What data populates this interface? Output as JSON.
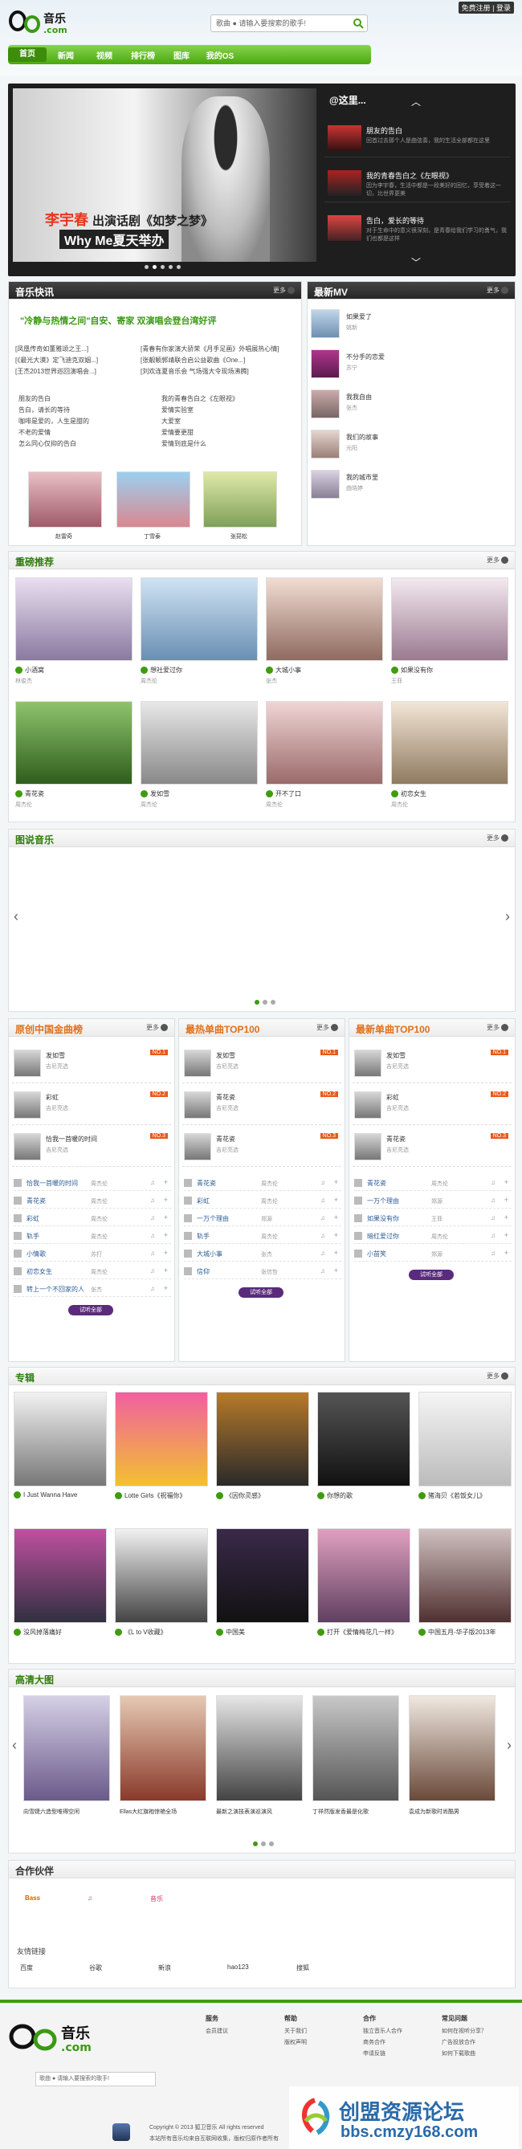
{
  "header": {
    "search_placeholder": "歌曲 ● 请输入要搜索的歌手!",
    "login": "免费注册 | 登录"
  },
  "nav": [
    "首页",
    "新闻",
    "视频",
    "排行榜",
    "图库",
    "我的OS"
  ],
  "banner": {
    "caption_name": "李宇春",
    "caption_title": "出演话剧《如梦之梦》",
    "caption_sub": "Why Me夏天举办",
    "side_title": "@这里...",
    "items": [
      {
        "title": "朋友的告白",
        "desc": "回首过去那个人是曲弦奏，我的生活全部都在这里"
      },
      {
        "title": "我的青春告白之《左眼视》",
        "desc": "因为李宇春，生活中都是一段美好的回忆，享受着这一切，比世界更美"
      },
      {
        "title": "告白，爱长的等待",
        "desc": "对于生命中的意义很深刻，是青春给我们学习的勇气，我们也都是这样"
      }
    ]
  },
  "news": {
    "title": "音乐快讯",
    "more": "更多",
    "headline": "\"冷静与热情之间\"自安、寄家 双演唱会登台湾好评",
    "lines_left": [
      "[凤凰传奇如董雅颂之王...]",
      "[《最光大漠》定飞迪克双姻...]",
      "[王杰2013世界巡回演唱会...]"
    ],
    "lines_right": [
      "[青春有你家演大骄荣《月手足画》外唱展热心情]",
      "[张靓颖郭靖联合启公益歌曲《One...]",
      "[刘欢连夏音乐会 气场强大令现场沸腾]"
    ],
    "list_left": [
      "朋友的告白",
      "告白，请长的等待",
      "咖啡是爱的，人生是甜的",
      "不老的爱情",
      "怎么同心仅抑的告白"
    ],
    "list_right": [
      "我的青春告白之《左眼视》",
      "爱情实验室",
      "大爱室",
      "爱情要更甜",
      "爱情到底是什么"
    ],
    "photos": [
      "赵雷奇",
      "丁雪泰",
      "张琵松"
    ]
  },
  "newmv": {
    "title": "最新MV",
    "more": "更多",
    "items": [
      {
        "t": "如果爱了",
        "a": "姚新"
      },
      {
        "t": "不分手的恋爱",
        "a": "苏宁"
      },
      {
        "t": "我我自由",
        "a": "张杰"
      },
      {
        "t": "我们的故事",
        "a": "光阳"
      },
      {
        "t": "我的城市里",
        "a": "曲晓婷"
      }
    ]
  },
  "recommend": {
    "title": "重磅推荐",
    "more": "更多",
    "items": [
      {
        "t": "小酒窝",
        "s": "林俊杰"
      },
      {
        "t": "想社爱过你",
        "s": "周杰伦"
      },
      {
        "t": "大城小事",
        "s": "张杰"
      },
      {
        "t": "如果没有你",
        "s": "王菲"
      },
      {
        "t": "青花瓷",
        "s": "周杰伦"
      },
      {
        "t": "发如雪",
        "s": "周杰伦"
      },
      {
        "t": "开不了口",
        "s": "周杰伦"
      },
      {
        "t": "初恋女生",
        "s": "周杰伦"
      }
    ]
  },
  "photomusic": {
    "title": "图说音乐",
    "more": "更多"
  },
  "charts": [
    {
      "title": "原创中国金曲榜",
      "more": "更多",
      "top": [
        {
          "t": "发如雪",
          "s": "吉尼亮选",
          "n": "NO.1"
        },
        {
          "t": "彩虹",
          "s": "吉尼亮选",
          "n": "NO.2"
        },
        {
          "t": "恰我一首暖的时间",
          "s": "吉尼亮选",
          "n": "NO.3"
        }
      ],
      "rows": [
        {
          "t": "恰我一首暖的时间",
          "s": "周杰伦"
        },
        {
          "t": "青花瓷",
          "s": "周杰伦"
        },
        {
          "t": "彩虹",
          "s": "周杰伦"
        },
        {
          "t": "轨手",
          "s": "周杰伦"
        },
        {
          "t": "小情歌",
          "s": "苏打"
        },
        {
          "t": "初恋女生",
          "s": "周杰伦"
        },
        {
          "t": "转上一个不回家的人",
          "s": "张杰"
        }
      ],
      "btn": "试听全部"
    },
    {
      "title": "最热单曲TOP100",
      "more": "更多",
      "top": [
        {
          "t": "发如雪",
          "s": "吉尼亮选",
          "n": "NO.1"
        },
        {
          "t": "青花瓷",
          "s": "吉尼亮选",
          "n": "NO.2"
        },
        {
          "t": "青花瓷",
          "s": "吉尼亮选",
          "n": "NO.3"
        }
      ],
      "rows": [
        {
          "t": "青花瓷",
          "s": "周杰伦"
        },
        {
          "t": "彩虹",
          "s": "周杰伦"
        },
        {
          "t": "一万个理由",
          "s": "郑源"
        },
        {
          "t": "轨手",
          "s": "周杰伦"
        },
        {
          "t": "大城小事",
          "s": "张杰"
        },
        {
          "t": "信仰",
          "s": "张信哲"
        }
      ],
      "btn": "试听全部"
    },
    {
      "title": "最新单曲TOP100",
      "more": "更多",
      "top": [
        {
          "t": "发如雪",
          "s": "吉尼亮选",
          "n": "NO.1"
        },
        {
          "t": "彩虹",
          "s": "吉尼亮选",
          "n": "NO.2"
        },
        {
          "t": "青花瓷",
          "s": "吉尼亮选",
          "n": "NO.3"
        }
      ],
      "rows": [
        {
          "t": "青花瓷",
          "s": "周杰伦"
        },
        {
          "t": "一万个理由",
          "s": "郑源"
        },
        {
          "t": "如果没有你",
          "s": "王菲"
        },
        {
          "t": "暗红爱过你",
          "s": "周杰伦"
        },
        {
          "t": "小苗笑",
          "s": "郑源"
        }
      ],
      "btn": "试听全部"
    }
  ],
  "album": {
    "title": "专辑",
    "more": "更多",
    "items": [
      "I Just Wanna Have",
      "Lotte Girls《祝福你》",
      "《因你灵感》",
      "你想的歌",
      "猪海贝《若饭女儿》",
      "没风掉落痛好",
      "《L to V收藏》",
      "中国美",
      "打开《爱情梅花几一样》",
      "中国五月-华子版2013年"
    ]
  },
  "hd": {
    "title": "高清大图",
    "items": [
      "向雪婕六造型唯得空闲",
      "Ellas大红旗袍惊艳全场",
      "最新之演技表演巡演风",
      "丁祥然版发香最是化歌",
      "袁成为新歌时尚酷男"
    ]
  },
  "partners": {
    "title": "合作伙伴",
    "logos": [
      "Bass",
      "♫",
      "音乐"
    ],
    "links_title": "友情链接",
    "links": [
      "百度",
      "谷歌",
      "新浪",
      "hao123",
      "搜狐"
    ]
  },
  "footer": {
    "cols": [
      {
        "h": "服务",
        "items": [
          "会员建议"
        ]
      },
      {
        "h": "帮助",
        "items": [
          "关于我们",
          "版权声明"
        ]
      },
      {
        "h": "合作",
        "items": [
          "独立音乐人合作",
          "商务合作",
          "申请反链"
        ]
      },
      {
        "h": "常见问题",
        "items": [
          "如何在视听分享？",
          "广告投放合作",
          "如何下载歌曲"
        ]
      }
    ],
    "copyright": "Copyright © 2013 狐卫音乐 All rights reserved",
    "icp": "本站所有音乐均来自互联网收集，版权归原作者所有",
    "search_placeholder": "歌曲 ● 请输入要搜索的歌手!",
    "watermark_cn": "创盟资源论坛",
    "watermark_url": "bbs.cmzy168.com"
  }
}
